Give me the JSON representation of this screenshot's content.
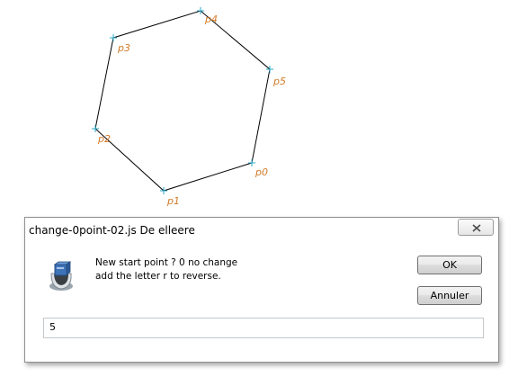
{
  "drawing": {
    "points": [
      {
        "label": "p0"
      },
      {
        "label": "p1"
      },
      {
        "label": "p2"
      },
      {
        "label": "p3"
      },
      {
        "label": "p4"
      },
      {
        "label": "p5"
      }
    ],
    "line_color": "#000000",
    "marker_color": "#2aa9c7",
    "label_color": "#d27a26"
  },
  "dialog": {
    "title": "change-0point-02.js De elleere",
    "prompt_line1": "New start point ? 0 no change",
    "prompt_line2": "add the letter r to reverse.",
    "ok_label": "OK",
    "cancel_label": "Annuler",
    "input_value": "5",
    "icon": "script-host-icon",
    "close_icon": "close-icon"
  }
}
